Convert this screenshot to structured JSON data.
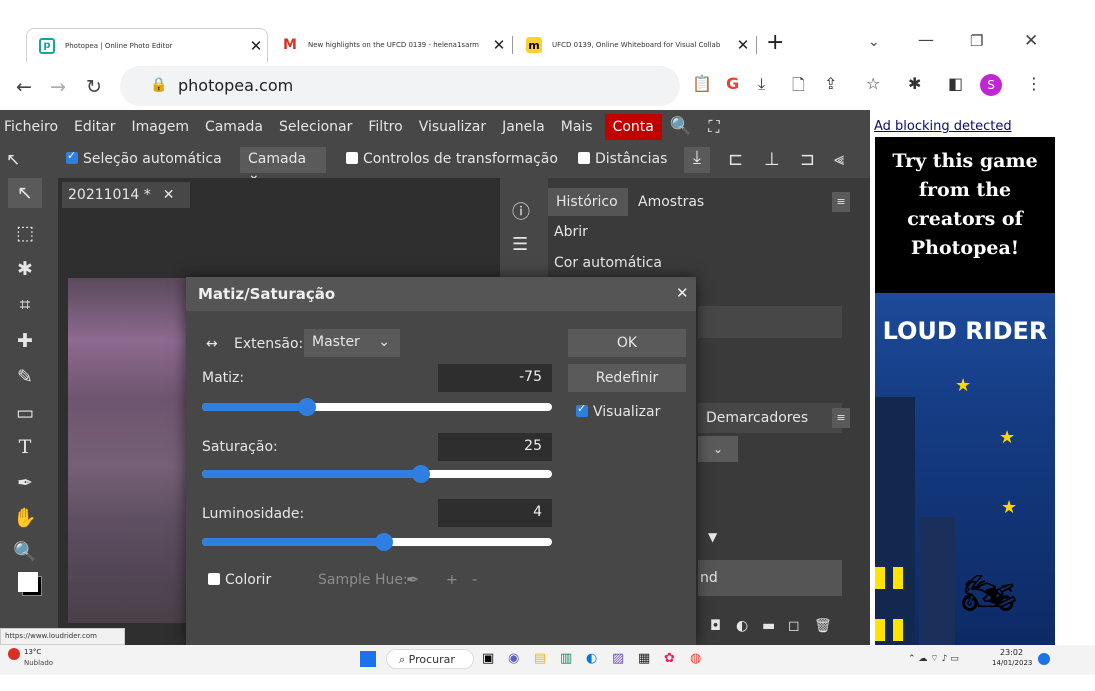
{
  "browser": {
    "tabs": [
      {
        "title": "Photopea | Online Photo Editor",
        "active": true
      },
      {
        "title": "New highlights on the UFCD 0139 - helena1sarm",
        "active": false
      },
      {
        "title": "UFCD 0139, Online Whiteboard for Visual Collab",
        "active": false
      }
    ],
    "url": "photopea.com",
    "new_tab_symbol": "+",
    "profile_initial": "S"
  },
  "menu": [
    "Ficheiro",
    "Editar",
    "Imagem",
    "Camada",
    "Selecionar",
    "Filtro",
    "Visualizar",
    "Janela",
    "Mais"
  ],
  "menu_account": "Conta",
  "options": {
    "auto_select": "Seleção automática",
    "layer_select": "Camada",
    "transform_controls": "Controlos de transformação",
    "distances": "Distâncias"
  },
  "document_tab": "20211014 *",
  "history": {
    "tabs": [
      "Histórico",
      "Amostras"
    ],
    "items": [
      "Abrir",
      "Cor automática"
    ]
  },
  "layers_panel_tab": "Demarcadores",
  "layers_fragment": "nd",
  "dialog": {
    "title": "Matiz/Saturação",
    "extension_label": "Extensão:",
    "extension_value": "Master",
    "hue_label": "Matiz:",
    "hue_value": "-75",
    "hue_fraction": 0.3,
    "saturation_label": "Saturação:",
    "saturation_value": "25",
    "saturation_fraction": 0.625,
    "lightness_label": "Luminosidade:",
    "lightness_value": "4",
    "lightness_fraction": 0.52,
    "ok": "OK",
    "reset": "Redefinir",
    "preview": "Visualizar",
    "colorize": "Colorir",
    "sample_hue": "Sample Hue:",
    "plus": "+",
    "minus": "-"
  },
  "ad": {
    "notice": "Ad blocking detected",
    "headline": "Try this game from the creators of Photopea!",
    "game": "LOUD RIDER"
  },
  "status_url": "https://www.loudrider.com",
  "taskbar": {
    "temp": "13°C",
    "weather": "Nublado",
    "search": "Procurar",
    "time": "23:02",
    "date": "14/01/2023"
  }
}
